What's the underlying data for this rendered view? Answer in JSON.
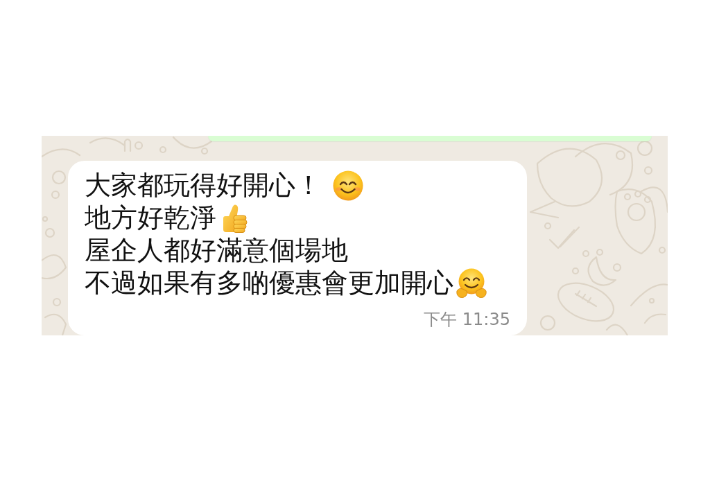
{
  "chat": {
    "message": {
      "lines": [
        {
          "kind": "smile",
          "text": "大家都玩得好開心！"
        },
        {
          "kind": "thumbs_up",
          "text": "地方好乾淨"
        },
        {
          "kind": "plain",
          "text": "屋企人都好滿意個場地"
        },
        {
          "kind": "hug",
          "text": "不過如果有多啲優惠會更加開心"
        }
      ],
      "time": "下午 11:35"
    }
  }
}
